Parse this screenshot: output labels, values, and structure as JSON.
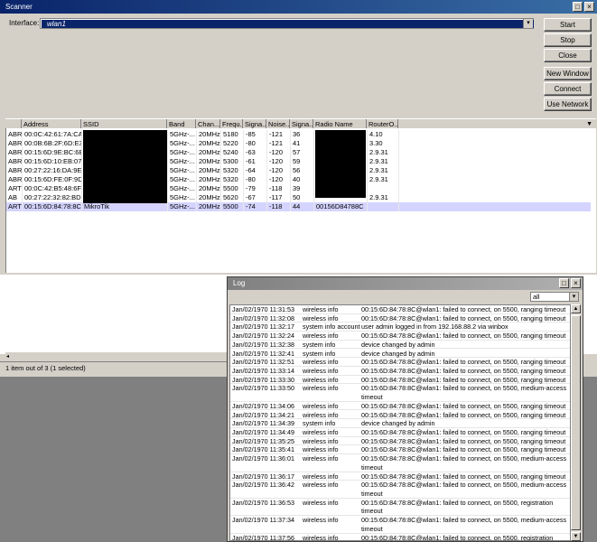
{
  "scanner": {
    "title": "Scanner",
    "interface_label": "Interface:",
    "interface_value": "wlan1",
    "buttons": {
      "start": "Start",
      "stop": "Stop",
      "close": "Close",
      "new_window": "New Window",
      "connect": "Connect",
      "use_network": "Use Network"
    },
    "columns": [
      "Address",
      "SSID",
      "Band",
      "Chan...",
      "Frequ...",
      "Signa...",
      "Noise...",
      "Signa...",
      "Radio Name",
      "RouterO..."
    ],
    "rows": [
      {
        "flags": "ABR",
        "address": "00:0C:42:61:7A:CA",
        "ssid": "l",
        "band": "5GHz-...",
        "chan": "20MHz",
        "freq": "5180",
        "signal": "-85",
        "noise": "-121",
        "snr": "36",
        "radio": "",
        "router": "4.10"
      },
      {
        "flags": "ABR",
        "address": "00:0B:6B:2F:6D:E3",
        "ssid": "S",
        "band": "5GHz-...",
        "chan": "20MHz",
        "freq": "5220",
        "signal": "-80",
        "noise": "-121",
        "snr": "41",
        "radio": "",
        "router": "3.30"
      },
      {
        "flags": "ABR",
        "address": "00:15:6D:9E:BC:6B",
        "ssid": "L",
        "band": "5GHz-...",
        "chan": "20MHz",
        "freq": "5240",
        "signal": "-63",
        "noise": "-120",
        "snr": "57",
        "radio": "",
        "router": "2.9.31"
      },
      {
        "flags": "ABR",
        "address": "00:15:6D:10:EB:07",
        "ssid": "",
        "band": "5GHz-...",
        "chan": "20MHz",
        "freq": "5300",
        "signal": "-61",
        "noise": "-120",
        "snr": "59",
        "radio": "",
        "router": "2.9.31"
      },
      {
        "flags": "ABR",
        "address": "00:27:22:16:DA:9E",
        "ssid": "S",
        "band": "5GHz-...",
        "chan": "20MHz",
        "freq": "5320",
        "signal": "-64",
        "noise": "-120",
        "snr": "56",
        "radio": "",
        "router": "2.9.31"
      },
      {
        "flags": "ABR",
        "address": "00:15:6D:FE:0F:9D",
        "ssid": "M",
        "band": "5GHz-...",
        "chan": "20MHz",
        "freq": "5320",
        "signal": "-80",
        "noise": "-120",
        "snr": "40",
        "radio": "",
        "router": "2.9.31"
      },
      {
        "flags": "ART",
        "address": "00:0C:42:B5:48:6F",
        "ssid": "S",
        "band": "5GHz-...",
        "chan": "20MHz",
        "freq": "5500",
        "signal": "-79",
        "noise": "-118",
        "snr": "39",
        "radio": "",
        "router": ""
      },
      {
        "flags": "AB",
        "address": "00:27:22:32:82:BD",
        "ssid": "S",
        "band": "5GHz-...",
        "chan": "20MHz",
        "freq": "5620",
        "signal": "-67",
        "noise": "-117",
        "snr": "50",
        "radio": "",
        "router": "2.9.31"
      },
      {
        "flags": "ART",
        "address": "00:15:6D:84:78:8C",
        "ssid": "MikroTik",
        "band": "5GHz-...",
        "chan": "20MHz",
        "freq": "5500",
        "signal": "-74",
        "noise": "-118",
        "snr": "44",
        "radio": "00156D84788C",
        "router": ""
      }
    ],
    "status": "1 item out of 3 (1 selected)"
  },
  "log": {
    "title": "Log",
    "filter": "all",
    "entries": [
      {
        "time": "Jan/02/1970 11:31:53",
        "topic": "wireless info",
        "msg": "00:15:6D:84:78:8C@wlan1: failed to connect, on 5500, ranging timeout"
      },
      {
        "time": "Jan/02/1970 11:32:08",
        "topic": "wireless info",
        "msg": "00:15:6D:84:78:8C@wlan1: failed to connect, on 5500, ranging timeout"
      },
      {
        "time": "Jan/02/1970 11:32:17",
        "topic": "system info account",
        "msg": "user admin logged in from 192.168.88.2 via winbox"
      },
      {
        "time": "Jan/02/1970 11:32:24",
        "topic": "wireless info",
        "msg": "00:15:6D:84:78:8C@wlan1: failed to connect, on 5500, ranging timeout"
      },
      {
        "time": "Jan/02/1970 11:32:38",
        "topic": "system info",
        "msg": "device changed by admin"
      },
      {
        "time": "Jan/02/1970 11:32:41",
        "topic": "system info",
        "msg": "device changed by admin"
      },
      {
        "time": "Jan/02/1970 11:32:51",
        "topic": "wireless info",
        "msg": "00:15:6D:84:78:8C@wlan1: failed to connect, on 5500, ranging timeout"
      },
      {
        "time": "Jan/02/1970 11:33:14",
        "topic": "wireless info",
        "msg": "00:15:6D:84:78:8C@wlan1: failed to connect, on 5500, ranging timeout"
      },
      {
        "time": "Jan/02/1970 11:33:30",
        "topic": "wireless info",
        "msg": "00:15:6D:84:78:8C@wlan1: failed to connect, on 5500, ranging timeout"
      },
      {
        "time": "Jan/02/1970 11:33:50",
        "topic": "wireless info",
        "msg": "00:15:6D:84:78:8C@wlan1: failed to connect, on 5500, medium-access timeout"
      },
      {
        "time": "Jan/02/1970 11:34:06",
        "topic": "wireless info",
        "msg": "00:15:6D:84:78:8C@wlan1: failed to connect, on 5500, ranging timeout"
      },
      {
        "time": "Jan/02/1970 11:34:21",
        "topic": "wireless info",
        "msg": "00:15:6D:84:78:8C@wlan1: failed to connect, on 5500, ranging timeout"
      },
      {
        "time": "Jan/02/1970 11:34:39",
        "topic": "system info",
        "msg": "device changed by admin"
      },
      {
        "time": "Jan/02/1970 11:34:49",
        "topic": "wireless info",
        "msg": "00:15:6D:84:78:8C@wlan1: failed to connect, on 5500, ranging timeout"
      },
      {
        "time": "Jan/02/1970 11:35:25",
        "topic": "wireless info",
        "msg": "00:15:6D:84:78:8C@wlan1: failed to connect, on 5500, ranging timeout"
      },
      {
        "time": "Jan/02/1970 11:35:41",
        "topic": "wireless info",
        "msg": "00:15:6D:84:78:8C@wlan1: failed to connect, on 5500, ranging timeout"
      },
      {
        "time": "Jan/02/1970 11:36:01",
        "topic": "wireless info",
        "msg": "00:15:6D:84:78:8C@wlan1: failed to connect, on 5500, medium-access timeout"
      },
      {
        "time": "Jan/02/1970 11:36:17",
        "topic": "wireless info",
        "msg": "00:15:6D:84:78:8C@wlan1: failed to connect, on 5500, ranging timeout"
      },
      {
        "time": "Jan/02/1970 11:36:42",
        "topic": "wireless info",
        "msg": "00:15:6D:84:78:8C@wlan1: failed to connect, on 5500, medium-access timeout"
      },
      {
        "time": "Jan/02/1970 11:36:53",
        "topic": "wireless info",
        "msg": "00:15:6D:84:78:8C@wlan1: failed to connect, on 5500, registration timeout"
      },
      {
        "time": "Jan/02/1970 11:37:34",
        "topic": "wireless info",
        "msg": "00:15:6D:84:78:8C@wlan1: failed to connect, on 5500, medium-access timeout"
      },
      {
        "time": "Jan/02/1970 11:37:56",
        "topic": "wireless info",
        "msg": "00:15:6D:84:78:8C@wlan1: failed to connect, on 5500, registration timeout"
      }
    ]
  }
}
